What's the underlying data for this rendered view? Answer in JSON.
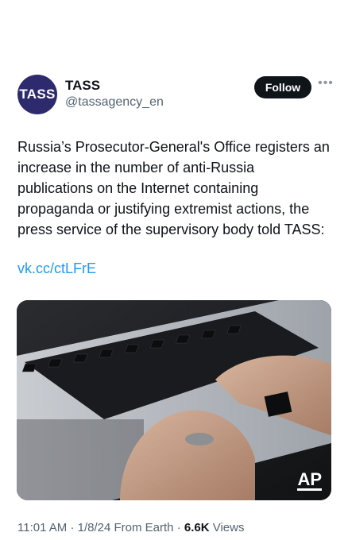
{
  "account": {
    "avatar_text": "TASS",
    "name": "TASS",
    "handle": "@tassagency_en",
    "follow_label": "Follow",
    "more_icon": "more-dots-icon"
  },
  "tweet": {
    "text": "Russia’s Prosecutor-General's Office registers an increase in the number of anti-Russia publications on the Internet containing propaganda or justifying extremist actions, the press service of the supervisory body told TASS:",
    "link": "vk.cc/ctLFrE",
    "media_watermark": "AP"
  },
  "meta": {
    "time": "11:01 AM",
    "date": "1/8/24",
    "source": "From Earth",
    "views_count": "6.6K",
    "views_label": "Views"
  },
  "colors": {
    "avatar_bg": "#2d2a6e",
    "link": "#1d9bf0",
    "follow_bg": "#0f1419",
    "secondary_text": "#536471"
  }
}
